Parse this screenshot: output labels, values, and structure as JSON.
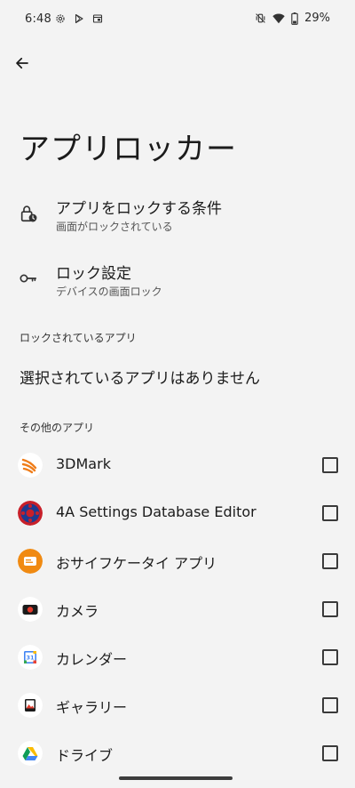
{
  "status_bar": {
    "time": "6:48",
    "left_icons": [
      "settings-gear-icon",
      "play-store-icon",
      "calendar-box-icon"
    ],
    "right_icons": [
      "vibrate-off-icon",
      "wifi-icon",
      "battery-icon"
    ],
    "battery": "29%"
  },
  "header": {
    "back_icon": "arrow-back-icon",
    "title": "アプリロッカー"
  },
  "settings": [
    {
      "icon": "lock-clock-icon",
      "title": "アプリをロックする条件",
      "subtitle": "画面がロックされている"
    },
    {
      "icon": "key-icon",
      "title": "ロック設定",
      "subtitle": "デバイスの画面ロック"
    }
  ],
  "locked_section": {
    "label": "ロックされているアプリ",
    "empty_message": "選択されているアプリはありません"
  },
  "other_section": {
    "label": "その他のアプリ",
    "apps": [
      {
        "name": "3DMark",
        "icon": "3dmark-icon",
        "checked": false
      },
      {
        "name": "4A Settings Database Editor",
        "icon": "4a-settings-icon",
        "checked": false
      },
      {
        "name": "おサイフケータイ アプリ",
        "icon": "osaifu-keitai-icon",
        "checked": false
      },
      {
        "name": "カメラ",
        "icon": "camera-icon",
        "checked": false
      },
      {
        "name": "カレンダー",
        "icon": "calendar-icon",
        "checked": false
      },
      {
        "name": "ギャラリー",
        "icon": "gallery-icon",
        "checked": false
      },
      {
        "name": "ドライブ",
        "icon": "drive-icon",
        "checked": false
      }
    ]
  },
  "colors": {
    "background": "#f3f3f3",
    "text_primary": "#1b1b1b",
    "text_secondary": "#555555"
  }
}
